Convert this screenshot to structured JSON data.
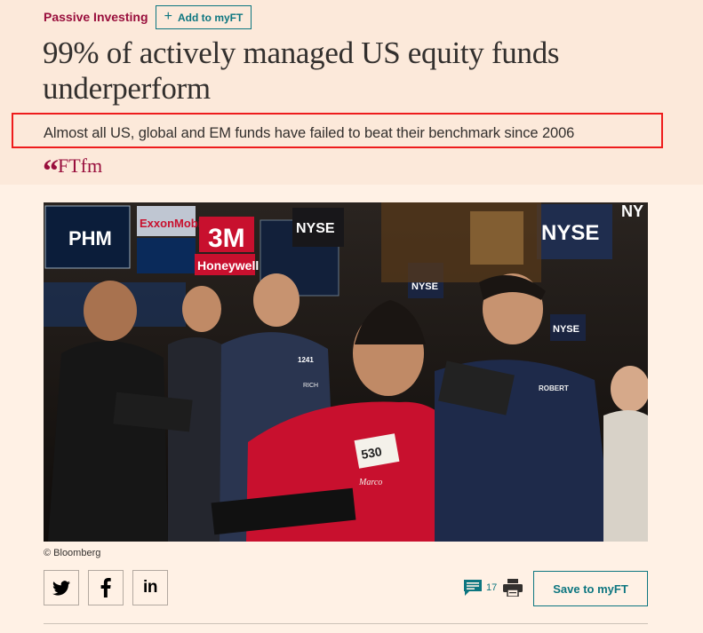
{
  "article": {
    "topic": "Passive Investing",
    "myft_button": "Add to myFT",
    "headline": "99% of actively managed US equity funds underperform",
    "standfirst": "Almost all US, global and EM funds have failed to beat their benchmark since 2006",
    "brand": "FTfm"
  },
  "photo": {
    "signs": [
      "PHM",
      "ExxonMobil",
      "3M",
      "Honeywell",
      "NYSE",
      "NYSE",
      "NYSE",
      "NYSE",
      "NY"
    ],
    "badges": [
      "530",
      "1241",
      "RICH",
      "ROBERT",
      "Marco"
    ],
    "credit": "© Bloomberg"
  },
  "toolbar": {
    "comment_count": "17",
    "save_label": "Save to myFT"
  },
  "icons": {
    "twitter": "twitter-icon",
    "facebook": "facebook-icon",
    "linkedin": "linkedin-icon",
    "comments": "comment-icon",
    "print": "print-icon"
  },
  "colors": {
    "background": "#fff1e5",
    "header_band": "#fce9da",
    "topic": "#990f3d",
    "teal": "#0d7680",
    "highlight_box": "#ee1c1c"
  }
}
